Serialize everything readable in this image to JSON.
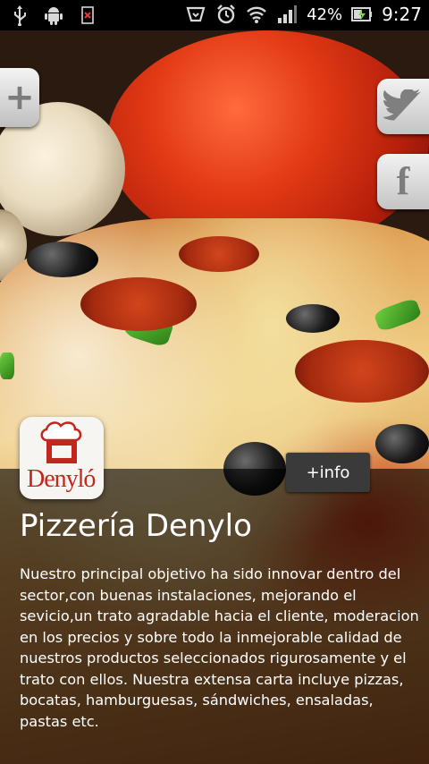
{
  "status_bar": {
    "battery": "42%",
    "time": "9:27",
    "icons": [
      "usb-icon",
      "android-icon",
      "no-sim-icon",
      "voicemail-icon",
      "alarm-icon",
      "wifi-icon",
      "signal-icon",
      "battery-icon"
    ]
  },
  "actions": {
    "add_label": "+",
    "facebook_label": "f",
    "info_label": "+info"
  },
  "logo": {
    "name": "Denyló"
  },
  "restaurant": {
    "title": "Pizzería Denylo",
    "description": "Nuestro principal objetivo ha sido innovar dentro del sector,con buenas instalaciones, mejorando el sevicio,un trato agradable hacia el cliente, moderacion en los precios y sobre todo la inmejorable calidad de nuestros productos seleccionados rigurosamente y el trato con ellos. Nuestra extensa carta incluye pizzas, bocatas, hamburguesas, sándwiches, ensaladas, pastas etc."
  },
  "colors": {
    "overlay": "#000000",
    "logo_red": "#c2271f",
    "button_dark": "#3a3a3a"
  }
}
